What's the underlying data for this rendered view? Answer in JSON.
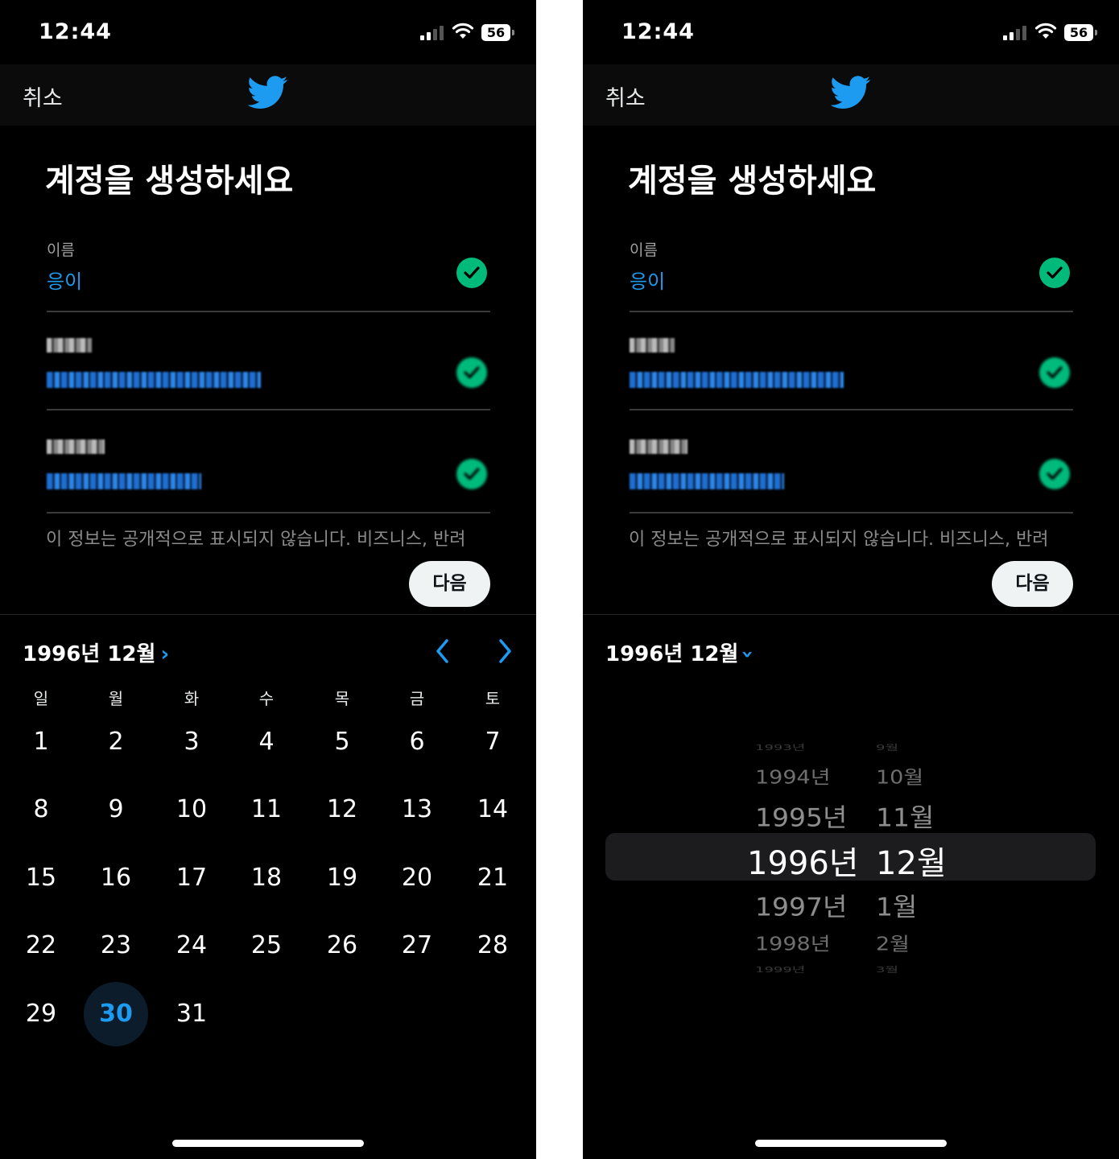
{
  "status": {
    "time": "12:44",
    "battery": "56"
  },
  "nav": {
    "cancel": "취소",
    "logo": "twitter-bird"
  },
  "form": {
    "title": "계정을 생성하세요",
    "name_label": "이름",
    "name_value": "응이",
    "note": "이 정보는 공개적으로 표시되지 않습니다. 비즈니스, 반려",
    "next": "다음"
  },
  "left_calendar": {
    "header": "1996년 12월",
    "weekdays": [
      "일",
      "월",
      "화",
      "수",
      "목",
      "금",
      "토"
    ],
    "days": [
      "1",
      "2",
      "3",
      "4",
      "5",
      "6",
      "7",
      "8",
      "9",
      "10",
      "11",
      "12",
      "13",
      "14",
      "15",
      "16",
      "17",
      "18",
      "19",
      "20",
      "21",
      "22",
      "23",
      "24",
      "25",
      "26",
      "27",
      "28",
      "29",
      "30",
      "31"
    ],
    "selected_day": "30"
  },
  "right_picker": {
    "header": "1996년 12월",
    "years": [
      "1993년",
      "1994년",
      "1995년",
      "1996년",
      "1997년",
      "1998년",
      "1999년"
    ],
    "months": [
      "9월",
      "10월",
      "11월",
      "12월",
      "1월",
      "2월",
      "3월"
    ],
    "selected_index": 3
  },
  "colors": {
    "accent": "#1d9bf0",
    "success": "#00ba7c",
    "background": "#000000"
  }
}
